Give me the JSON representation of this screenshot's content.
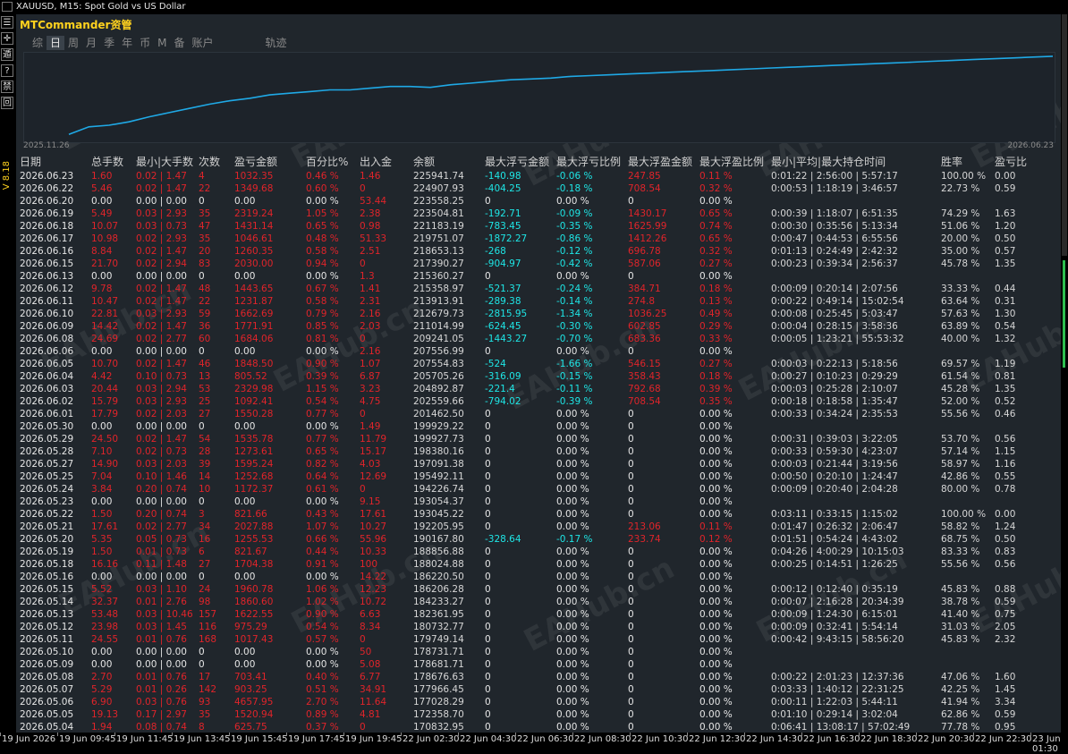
{
  "window": {
    "title": "XAUUSD, M15:  Spot Gold vs US Dollar"
  },
  "app": {
    "title": "MTCommander资管",
    "version": "V 8.18"
  },
  "tabs": [
    {
      "label": "综",
      "active": false
    },
    {
      "label": "日",
      "active": true
    },
    {
      "label": "周",
      "active": false
    },
    {
      "label": "月",
      "active": false
    },
    {
      "label": "季",
      "active": false
    },
    {
      "label": "年",
      "active": false
    },
    {
      "label": "币",
      "active": false
    },
    {
      "label": "M",
      "active": false
    },
    {
      "label": "备",
      "active": false
    },
    {
      "label": "账户",
      "active": false
    },
    {
      "label": "轨迹",
      "active": false
    }
  ],
  "left_tools": [
    "☰",
    "✛",
    "遁",
    "?",
    "禁",
    "回"
  ],
  "watermark": "EAHub.cn",
  "chart_data": {
    "type": "line",
    "x_start_label": "2025.11.26",
    "x_end_label": "2026.06.23",
    "color": "#1fa9e6",
    "values": [
      0.05,
      0.14,
      0.16,
      0.2,
      0.26,
      0.31,
      0.36,
      0.41,
      0.45,
      0.48,
      0.52,
      0.54,
      0.56,
      0.58,
      0.58,
      0.6,
      0.62,
      0.62,
      0.61,
      0.64,
      0.66,
      0.68,
      0.7,
      0.71,
      0.72,
      0.74,
      0.75,
      0.76,
      0.77,
      0.78,
      0.79,
      0.8,
      0.81,
      0.82,
      0.83,
      0.84,
      0.85,
      0.86,
      0.87,
      0.88,
      0.89,
      0.9,
      0.91,
      0.92,
      0.93,
      0.94,
      0.95,
      0.96,
      0.97,
      0.98
    ]
  },
  "table": {
    "headers": [
      "日期",
      "总手数",
      "最小|大手数",
      "次数",
      "盈亏金额",
      "百分比%",
      "出入金",
      "余额",
      "最大浮亏金额",
      "最大浮亏比例",
      "最大浮盈金额",
      "最大浮盈比例",
      "最小|平均|最大持仓时间",
      "胜率",
      "盈亏比"
    ],
    "rows": [
      [
        "2026.06.23",
        "1.60",
        "0.02 | 1.47",
        "4",
        "1032.35",
        "0.46 %",
        "1.46",
        "225941.74",
        "-140.98",
        "-0.06 %",
        "247.85",
        "0.11 %",
        "0:01:22 | 2:56:00 | 5:57:17",
        "100.00 %",
        "0.00"
      ],
      [
        "2026.06.22",
        "5.46",
        "0.02 | 1.47",
        "22",
        "1349.68",
        "0.60 %",
        "0",
        "224907.93",
        "-404.25",
        "-0.18 %",
        "708.54",
        "0.32 %",
        "0:00:53 | 1:18:19 | 3:46:57",
        "22.73 %",
        "0.59"
      ],
      [
        "2026.06.20",
        "0.00",
        "0.00 | 0.00",
        "0",
        "0.00",
        "0.00 %",
        "53.44",
        "223558.25",
        "0",
        "0.00 %",
        "0",
        "0.00 %",
        "",
        "",
        ""
      ],
      [
        "2026.06.19",
        "5.49",
        "0.03 | 2.93",
        "35",
        "2319.24",
        "1.05 %",
        "2.38",
        "223504.81",
        "-192.71",
        "-0.09 %",
        "1430.17",
        "0.65 %",
        "0:00:39 | 1:18:07 | 6:51:35",
        "74.29 %",
        "1.63"
      ],
      [
        "2026.06.18",
        "10.07",
        "0.03 | 0.73",
        "47",
        "1431.14",
        "0.65 %",
        "0.98",
        "221183.19",
        "-783.45",
        "-0.35 %",
        "1625.99",
        "0.74 %",
        "0:00:30 | 0:35:56 | 5:13:34",
        "51.06 %",
        "1.20"
      ],
      [
        "2026.06.17",
        "10.98",
        "0.02 | 2.93",
        "35",
        "1046.61",
        "0.48 %",
        "51.33",
        "219751.07",
        "-1872.27",
        "-0.86 %",
        "1412.26",
        "0.65 %",
        "0:00:47 | 0:44:53 | 6:55:56",
        "20.00 %",
        "0.50"
      ],
      [
        "2026.06.16",
        "8.84",
        "0.02 | 1.47",
        "20",
        "1260.35",
        "0.58 %",
        "2.51",
        "218653.13",
        "-268",
        "-0.12 %",
        "696.78",
        "0.32 %",
        "0:01:13 | 0:24:49 | 2:42:32",
        "35.00 %",
        "0.57"
      ],
      [
        "2026.06.15",
        "21.70",
        "0.02 | 2.94",
        "83",
        "2030.00",
        "0.94 %",
        "0",
        "217390.27",
        "-904.97",
        "-0.42 %",
        "587.06",
        "0.27 %",
        "0:00:23 | 0:39:34 | 2:56:37",
        "45.78 %",
        "1.35"
      ],
      [
        "2026.06.13",
        "0.00",
        "0.00 | 0.00",
        "0",
        "0.00",
        "0.00 %",
        "1.3",
        "215360.27",
        "0",
        "0.00 %",
        "0",
        "0.00 %",
        "",
        "",
        ""
      ],
      [
        "2026.06.12",
        "9.78",
        "0.02 | 1.47",
        "48",
        "1443.65",
        "0.67 %",
        "1.41",
        "215358.97",
        "-521.37",
        "-0.24 %",
        "384.71",
        "0.18 %",
        "0:00:09 | 0:20:14 | 2:07:56",
        "33.33 %",
        "0.44"
      ],
      [
        "2026.06.11",
        "10.47",
        "0.02 | 1.47",
        "22",
        "1231.87",
        "0.58 %",
        "2.31",
        "213913.91",
        "-289.38",
        "-0.14 %",
        "274.8",
        "0.13 %",
        "0:00:22 | 0:49:14 | 15:02:54",
        "63.64 %",
        "0.31"
      ],
      [
        "2026.06.10",
        "22.81",
        "0.03 | 2.93",
        "59",
        "1662.69",
        "0.79 %",
        "2.16",
        "212679.73",
        "-2815.95",
        "-1.34 %",
        "1036.25",
        "0.49 %",
        "0:00:08 | 0:25:45 | 5:03:47",
        "57.63 %",
        "1.30"
      ],
      [
        "2026.06.09",
        "14.42",
        "0.02 | 1.47",
        "36",
        "1771.91",
        "0.85 %",
        "2.03",
        "211014.99",
        "-624.45",
        "-0.30 %",
        "602.85",
        "0.29 %",
        "0:00:04 | 0:28:15 | 3:58:36",
        "63.89 %",
        "0.54"
      ],
      [
        "2026.06.08",
        "24.69",
        "0.02 | 2.77",
        "60",
        "1684.06",
        "0.81 %",
        "0",
        "209241.05",
        "-1443.27",
        "-0.70 %",
        "683.36",
        "0.33 %",
        "0:00:05 | 1:23:21 | 55:53:32",
        "40.00 %",
        "1.32"
      ],
      [
        "2026.06.06",
        "0.00",
        "0.00 | 0.00",
        "0",
        "0.00",
        "0.00 %",
        "2.16",
        "207556.99",
        "0",
        "0.00 %",
        "0",
        "0.00 %",
        "",
        "",
        ""
      ],
      [
        "2026.06.05",
        "10.70",
        "0.02 | 1.47",
        "46",
        "1848.50",
        "0.90 %",
        "1.07",
        "207554.83",
        "-524",
        "-1.66 %",
        "546.15",
        "0.27 %",
        "0:00:03 | 0:22:13 | 5:18:56",
        "69.57 %",
        "1.19"
      ],
      [
        "2026.06.04",
        "4.42",
        "0.10 | 0.73",
        "13",
        "805.52",
        "0.39 %",
        "6.87",
        "205705.26",
        "-316.09",
        "-0.15 %",
        "358.43",
        "0.18 %",
        "0:00:27 | 0:10:23 | 0:29:29",
        "61.54 %",
        "0.81"
      ],
      [
        "2026.06.03",
        "20.44",
        "0.03 | 2.94",
        "53",
        "2329.98",
        "1.15 %",
        "3.23",
        "204892.87",
        "-221.4",
        "-0.11 %",
        "792.68",
        "0.39 %",
        "0:00:03 | 0:25:28 | 2:10:07",
        "45.28 %",
        "1.35"
      ],
      [
        "2026.06.02",
        "15.79",
        "0.03 | 2.93",
        "25",
        "1092.41",
        "0.54 %",
        "4.75",
        "202559.66",
        "-794.02",
        "-0.39 %",
        "708.54",
        "0.35 %",
        "0:00:18 | 0:18:58 | 1:35:47",
        "52.00 %",
        "0.52"
      ],
      [
        "2026.06.01",
        "17.79",
        "0.02 | 2.03",
        "27",
        "1550.28",
        "0.77 %",
        "0",
        "201462.50",
        "0",
        "0.00 %",
        "0",
        "0.00 %",
        "0:00:33 | 0:34:24 | 2:35:53",
        "55.56 %",
        "0.46"
      ],
      [
        "2026.05.30",
        "0.00",
        "0.00 | 0.00",
        "0",
        "0.00",
        "0.00 %",
        "1.49",
        "199929.22",
        "0",
        "0.00 %",
        "0",
        "0.00 %",
        "",
        "",
        ""
      ],
      [
        "2026.05.29",
        "24.50",
        "0.02 | 1.47",
        "54",
        "1535.78",
        "0.77 %",
        "11.79",
        "199927.73",
        "0",
        "0.00 %",
        "0",
        "0.00 %",
        "0:00:31 | 0:39:03 | 3:22:05",
        "53.70 %",
        "0.56"
      ],
      [
        "2026.05.28",
        "7.10",
        "0.02 | 0.73",
        "28",
        "1273.61",
        "0.65 %",
        "15.17",
        "198380.16",
        "0",
        "0.00 %",
        "0",
        "0.00 %",
        "0:00:33 | 0:59:30 | 4:23:07",
        "57.14 %",
        "1.15"
      ],
      [
        "2026.05.27",
        "14.90",
        "0.03 | 2.03",
        "39",
        "1595.24",
        "0.82 %",
        "4.03",
        "197091.38",
        "0",
        "0.00 %",
        "0",
        "0.00 %",
        "0:00:03 | 0:21:44 | 3:19:56",
        "58.97 %",
        "1.16"
      ],
      [
        "2026.05.25",
        "7.04",
        "0.10 | 1.46",
        "14",
        "1252.68",
        "0.64 %",
        "12.69",
        "195492.11",
        "0",
        "0.00 %",
        "0",
        "0.00 %",
        "0:00:50 | 0:20:10 | 1:24:47",
        "42.86 %",
        "0.55"
      ],
      [
        "2026.05.24",
        "3.84",
        "0.20 | 0.74",
        "10",
        "1172.37",
        "0.61 %",
        "0",
        "194226.74",
        "0",
        "0.00 %",
        "0",
        "0.00 %",
        "0:00:09 | 0:20:40 | 2:04:28",
        "80.00 %",
        "0.78"
      ],
      [
        "2026.05.23",
        "0.00",
        "0.00 | 0.00",
        "0",
        "0.00",
        "0.00 %",
        "9.15",
        "193054.37",
        "0",
        "0.00 %",
        "0",
        "0.00 %",
        "",
        "",
        ""
      ],
      [
        "2026.05.22",
        "1.50",
        "0.20 | 0.74",
        "3",
        "821.66",
        "0.43 %",
        "17.61",
        "193045.22",
        "0",
        "0.00 %",
        "0",
        "0.00 %",
        "0:03:11 | 0:33:15 | 1:15:02",
        "100.00 %",
        "0.00"
      ],
      [
        "2026.05.21",
        "17.61",
        "0.02 | 2.77",
        "34",
        "2027.88",
        "1.07 %",
        "10.27",
        "192205.95",
        "0",
        "0.00 %",
        "213.06",
        "0.11 %",
        "0:01:47 | 0:26:32 | 2:06:47",
        "58.82 %",
        "1.24"
      ],
      [
        "2026.05.20",
        "5.35",
        "0.05 | 0.73",
        "16",
        "1255.53",
        "0.66 %",
        "55.96",
        "190167.80",
        "-328.64",
        "-0.17 %",
        "233.74",
        "0.12 %",
        "0:01:51 | 0:54:24 | 4:43:02",
        "68.75 %",
        "0.50"
      ],
      [
        "2026.05.19",
        "1.50",
        "0.01 | 0.73",
        "6",
        "821.67",
        "0.44 %",
        "10.33",
        "188856.88",
        "0",
        "0.00 %",
        "0",
        "0.00 %",
        "0:04:26 | 4:00:29 | 10:15:03",
        "83.33 %",
        "0.83"
      ],
      [
        "2026.05.18",
        "16.16",
        "0.11 | 1.48",
        "27",
        "1704.38",
        "0.91 %",
        "100",
        "188024.88",
        "0",
        "0.00 %",
        "0",
        "0.00 %",
        "0:00:25 | 0:14:51 | 1:26:25",
        "55.56 %",
        "0.56"
      ],
      [
        "2026.05.16",
        "0.00",
        "0.00 | 0.00",
        "0",
        "0.00",
        "0.00 %",
        "14.22",
        "186220.50",
        "0",
        "0.00 %",
        "0",
        "0.00 %",
        "",
        "",
        ""
      ],
      [
        "2026.05.15",
        "5.52",
        "0.03 | 1.10",
        "24",
        "1960.78",
        "1.06 %",
        "12.23",
        "186206.28",
        "0",
        "0.00 %",
        "0",
        "0.00 %",
        "0:00:12 | 0:12:40 | 0:35:19",
        "45.83 %",
        "0.88"
      ],
      [
        "2026.05.14",
        "32.37",
        "0.01 | 2.76",
        "98",
        "1860.60",
        "1.02 %",
        "10.72",
        "184233.27",
        "0",
        "0.00 %",
        "0",
        "0.00 %",
        "0:00:07 | 2:16:28 | 20:34:39",
        "38.78 %",
        "0.59"
      ],
      [
        "2026.05.13",
        "53.48",
        "0.03 | 10.46",
        "157",
        "1622.55",
        "0.90 %",
        "6.63",
        "182361.95",
        "0",
        "0.00 %",
        "0",
        "0.00 %",
        "0:00:09 | 1:24:30 | 6:15:01",
        "41.40 %",
        "0.75"
      ],
      [
        "2026.05.12",
        "23.98",
        "0.03 | 1.45",
        "116",
        "975.29",
        "0.54 %",
        "8.34",
        "180732.77",
        "0",
        "0.00 %",
        "0",
        "0.00 %",
        "0:00:09 | 0:32:41 | 5:54:14",
        "31.03 %",
        "2.05"
      ],
      [
        "2026.05.11",
        "24.55",
        "0.01 | 0.76",
        "168",
        "1017.43",
        "0.57 %",
        "0",
        "179749.14",
        "0",
        "0.00 %",
        "0",
        "0.00 %",
        "0:00:42 | 9:43:15 | 58:56:20",
        "45.83 %",
        "2.32"
      ],
      [
        "2026.05.10",
        "0.00",
        "0.00 | 0.00",
        "0",
        "0.00",
        "0.00 %",
        "50",
        "178731.71",
        "0",
        "0.00 %",
        "0",
        "0.00 %",
        "",
        "",
        ""
      ],
      [
        "2026.05.09",
        "0.00",
        "0.00 | 0.00",
        "0",
        "0.00",
        "0.00 %",
        "5.08",
        "178681.71",
        "0",
        "0.00 %",
        "0",
        "0.00 %",
        "",
        "",
        ""
      ],
      [
        "2026.05.08",
        "2.70",
        "0.01 | 0.76",
        "17",
        "703.41",
        "0.40 %",
        "6.77",
        "178676.63",
        "0",
        "0.00 %",
        "0",
        "0.00 %",
        "0:00:22 | 2:01:23 | 12:37:36",
        "47.06 %",
        "1.60"
      ],
      [
        "2026.05.07",
        "5.29",
        "0.01 | 0.26",
        "142",
        "903.25",
        "0.51 %",
        "34.91",
        "177966.45",
        "0",
        "0.00 %",
        "0",
        "0.00 %",
        "0:03:33 | 1:40:12 | 22:31:25",
        "42.25 %",
        "1.45"
      ],
      [
        "2026.05.06",
        "6.90",
        "0.03 | 0.76",
        "93",
        "4657.95",
        "2.70 %",
        "11.64",
        "177028.29",
        "0",
        "0.00 %",
        "0",
        "0.00 %",
        "0:00:11 | 1:22:03 | 5:44:11",
        "41.94 %",
        "3.34"
      ],
      [
        "2026.05.05",
        "19.13",
        "0.17 | 2.97",
        "35",
        "1520.94",
        "0.89 %",
        "4.81",
        "172358.70",
        "0",
        "0.00 %",
        "0",
        "0.00 %",
        "0:01:10 | 0:29:14 | 3:02:04",
        "62.86 %",
        "0.59"
      ],
      [
        "2026.05.04",
        "1.94",
        "0.08 | 0.74",
        "8",
        "625.75",
        "0.37 %",
        "0",
        "170832.95",
        "0",
        "0.00 %",
        "0",
        "0.00 %",
        "0:06:41 | 13:08:17 | 57:02:49",
        "77.78 %",
        "0.95"
      ]
    ]
  },
  "time_axis": [
    "19 Jun 2026",
    "19 Jun 09:45",
    "19 Jun 11:45",
    "19 Jun 13:45",
    "19 Jun 15:45",
    "19 Jun 17:45",
    "19 Jun 19:45",
    "22 Jun 02:30",
    "22 Jun 04:30",
    "22 Jun 06:30",
    "22 Jun 08:30",
    "22 Jun 10:30",
    "22 Jun 12:30",
    "22 Jun 14:30",
    "22 Jun 16:30",
    "22 Jun 18:30",
    "22 Jun 20:30",
    "22 Jun 22:30",
    "23 Jun 01:30"
  ]
}
